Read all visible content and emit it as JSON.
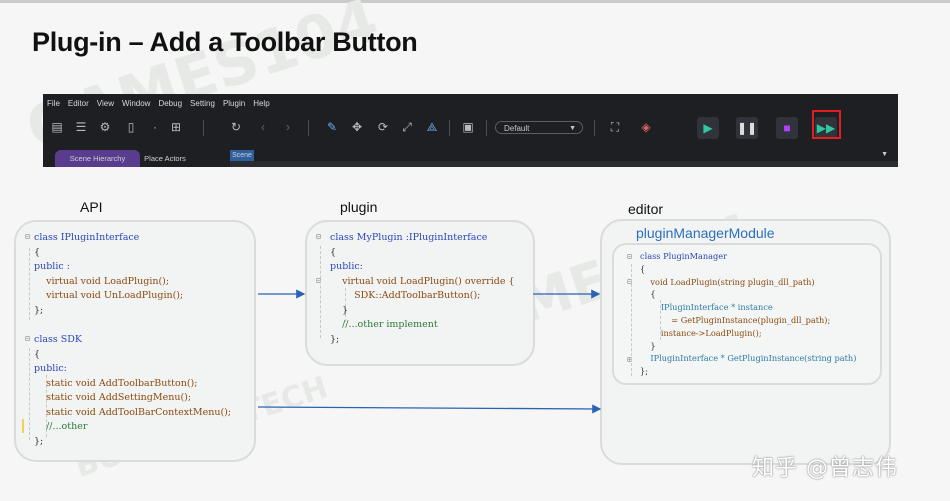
{
  "slide": {
    "title": "Plug-in – Add a Toolbar Button",
    "watermarks": [
      "GAMES104",
      "BOOMING TECH"
    ]
  },
  "editor": {
    "menu": [
      "File",
      "Editor",
      "View",
      "Window",
      "Debug",
      "Setting",
      "Plugin",
      "Help"
    ],
    "dropdown": "Default",
    "tabs": {
      "scene_hierarchy": "Scene Hierarchy",
      "place_actors": "Place Actors",
      "scene": "Scene"
    },
    "toolbar_icons": [
      "save-icon",
      "list-icon",
      "gear-cloud-icon",
      "document-icon",
      "dot-icon",
      "add-file-icon",
      "refresh-icon",
      "back-icon",
      "forward-icon",
      "pencil-icon",
      "move-icon",
      "rotate-icon",
      "scale-icon",
      "transform-icon",
      "snap-icon",
      "frame-icon",
      "cube-icon",
      "play-icon",
      "pause-icon",
      "stop-icon",
      "fast-forward-icon"
    ],
    "highlight_color": "#e02020",
    "play_color": "#2fc7a0",
    "stop_color": "#b042ff"
  },
  "diagram": {
    "api_label": "API",
    "plugin_label": "plugin",
    "editor_label": "editor",
    "module_title": "pluginManagerModule",
    "api_code1": {
      "l1": "class IPluginInterface",
      "l2": "{",
      "l3": "public :",
      "l4": "    virtual void LoadPlugin();",
      "l5": "    virtual void UnLoadPlugin();",
      "l6": "};"
    },
    "api_code2": {
      "l1": "class SDK",
      "l2": "{",
      "l3": "public:",
      "l4": "    static void AddToolbarButton();",
      "l5": "    static void AddSettingMenu();",
      "l6": "    static void AddToolBarContextMenu();",
      "l7": "    //...other",
      "l8": "};"
    },
    "plugin_code": {
      "l1": "class MyPlugin :IPluginInterface",
      "l2": "{",
      "l3": "public:",
      "l4": "    virtual void LoadPlugin() override {",
      "l5": "        SDK::AddToolbarButton();",
      "l6": "    }",
      "l7": "    //...other implement",
      "l8": "};"
    },
    "editor_code": {
      "l1": "class PluginManager",
      "l2": "{",
      "l3": "    void LoadPlugin(string plugin_dll_path)",
      "l4": "    {",
      "l5": "        IPluginInterface * instance",
      "l6": "            = GetPluginInstance(plugin_dll_path);",
      "l7": "        instance->LoadPlugin();",
      "l8": "    }",
      "l9": "    IPluginInterface * GetPluginInstance(string path)",
      "l10": "};"
    }
  },
  "brand": "知乎 @曾志伟"
}
